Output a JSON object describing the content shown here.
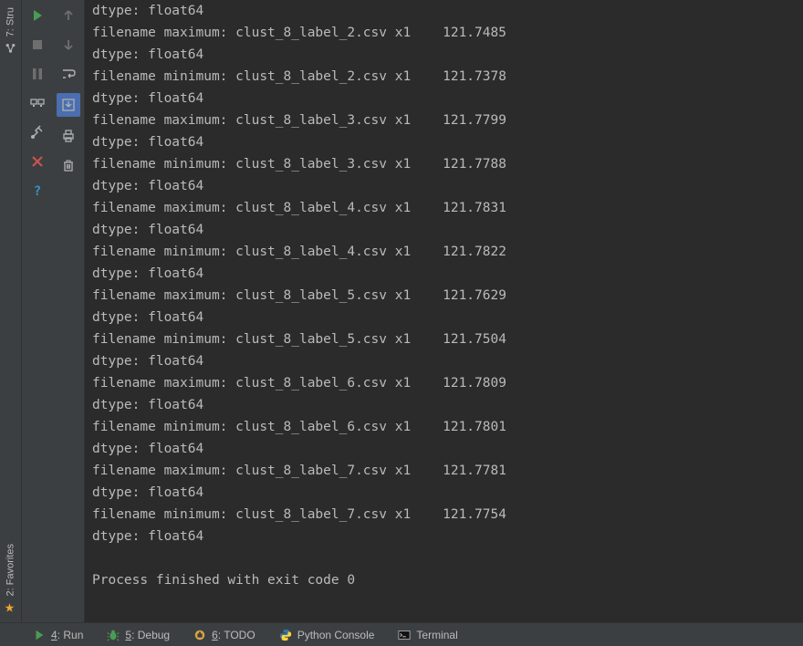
{
  "left_tabs": {
    "structure": "7: Stru",
    "favorites": "2: Favorites"
  },
  "console": {
    "rows": [
      {
        "label": "filename maximum:",
        "file": "clust_8_label_2.csv",
        "col": "x1",
        "val": "121.7485"
      },
      {
        "label": "filename minimum:",
        "file": "clust_8_label_2.csv",
        "col": "x1",
        "val": "121.7378"
      },
      {
        "label": "filename maximum:",
        "file": "clust_8_label_3.csv",
        "col": "x1",
        "val": "121.7799"
      },
      {
        "label": "filename minimum:",
        "file": "clust_8_label_3.csv",
        "col": "x1",
        "val": "121.7788"
      },
      {
        "label": "filename maximum:",
        "file": "clust_8_label_4.csv",
        "col": "x1",
        "val": "121.7831"
      },
      {
        "label": "filename minimum:",
        "file": "clust_8_label_4.csv",
        "col": "x1",
        "val": "121.7822"
      },
      {
        "label": "filename maximum:",
        "file": "clust_8_label_5.csv",
        "col": "x1",
        "val": "121.7629"
      },
      {
        "label": "filename minimum:",
        "file": "clust_8_label_5.csv",
        "col": "x1",
        "val": "121.7504"
      },
      {
        "label": "filename maximum:",
        "file": "clust_8_label_6.csv",
        "col": "x1",
        "val": "121.7809"
      },
      {
        "label": "filename minimum:",
        "file": "clust_8_label_6.csv",
        "col": "x1",
        "val": "121.7801"
      },
      {
        "label": "filename maximum:",
        "file": "clust_8_label_7.csv",
        "col": "x1",
        "val": "121.7781"
      },
      {
        "label": "filename minimum:",
        "file": "clust_8_label_7.csv",
        "col": "x1",
        "val": "121.7754"
      }
    ],
    "dtype": "dtype: float64",
    "finished": "Process finished with exit code 0"
  },
  "bottom_bar": {
    "run": {
      "num": "4",
      "label": ": Run"
    },
    "debug": {
      "num": "5",
      "label": ": Debug"
    },
    "todo": {
      "num": "6",
      "label": ": TODO"
    },
    "python_console": "Python Console",
    "terminal": "Terminal"
  }
}
